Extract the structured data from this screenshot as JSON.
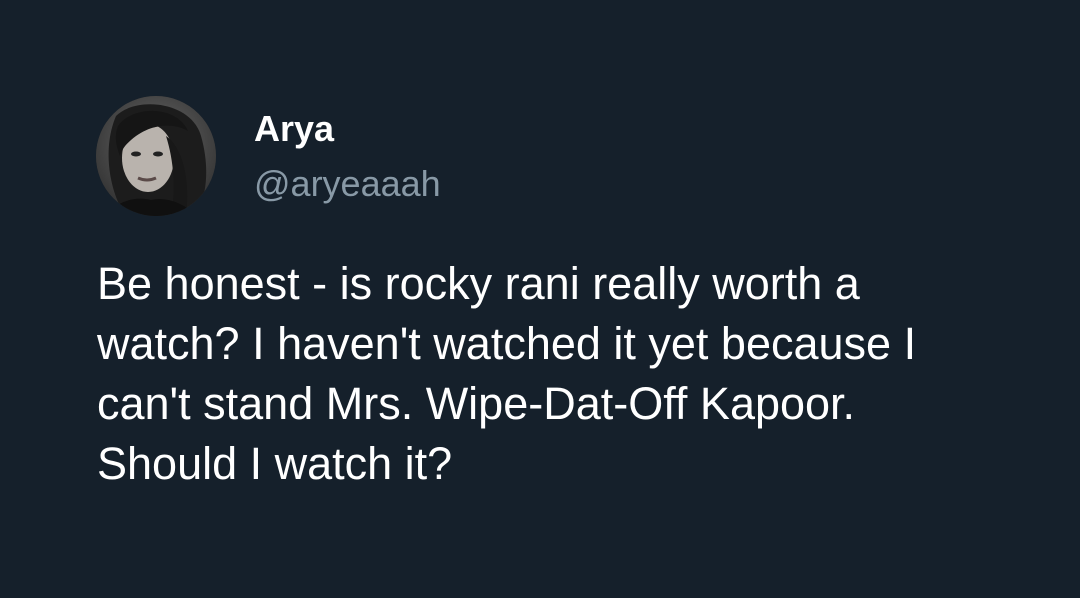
{
  "tweet": {
    "author": {
      "display_name": "Arya",
      "handle": "@aryeaaah",
      "avatar_icon": "profile-photo"
    },
    "text": "Be honest - is rocky rani really worth a watch? I haven't watched it yet because I can't stand Mrs. Wipe-Dat-Off Kapoor. Should I watch it?"
  },
  "colors": {
    "background": "#15202b",
    "name": "#ffffff",
    "handle": "#8899a6",
    "text": "#ffffff"
  }
}
